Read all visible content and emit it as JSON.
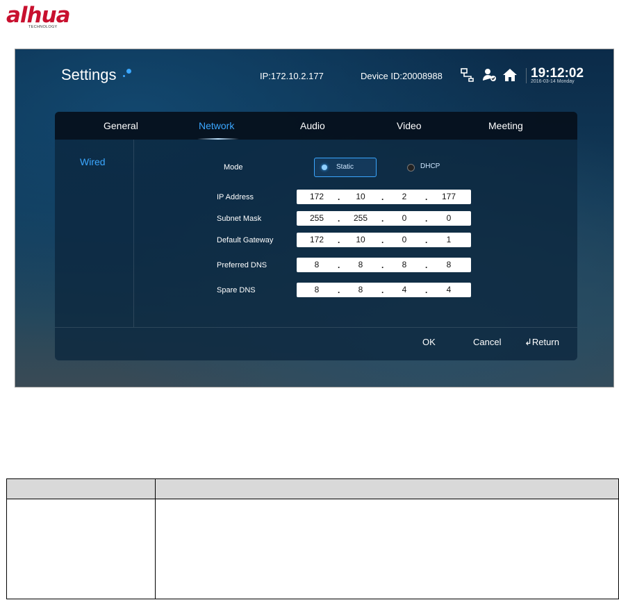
{
  "brand": {
    "logo": "alhua",
    "sub": "TECHNOLOGY"
  },
  "header": {
    "title": "Settings",
    "ip": "IP:172.10.2.177",
    "device_id": "Device ID:20008988",
    "time": "19:12:02",
    "date": "2016-03-14 Monday",
    "icons": [
      "network-icon",
      "user-check-icon",
      "home-icon"
    ]
  },
  "tabs": [
    "General",
    "Network",
    "Audio",
    "Video",
    "Meeting"
  ],
  "active_tab": "Network",
  "sidebar": {
    "items": [
      "Wired"
    ]
  },
  "form": {
    "mode_label": "Mode",
    "mode_options": [
      "Static",
      "DHCP"
    ],
    "mode_selected": "Static",
    "fields": [
      {
        "label": "IP Address",
        "octets": [
          "172",
          "10",
          "2",
          "177"
        ]
      },
      {
        "label": "Subnet Mask",
        "octets": [
          "255",
          "255",
          "0",
          "0"
        ]
      },
      {
        "label": "Default Gateway",
        "octets": [
          "172",
          "10",
          "0",
          "1"
        ]
      },
      {
        "label": "Preferred DNS",
        "octets": [
          "8",
          "8",
          "8",
          "8"
        ]
      },
      {
        "label": "Spare DNS",
        "octets": [
          "8",
          "8",
          "4",
          "4"
        ]
      }
    ],
    "separator": "."
  },
  "actions": {
    "ok": "OK",
    "cancel": "Cancel",
    "return": "Return"
  },
  "colors": {
    "accent": "#3ba7ff",
    "brand": "#c8102e"
  }
}
